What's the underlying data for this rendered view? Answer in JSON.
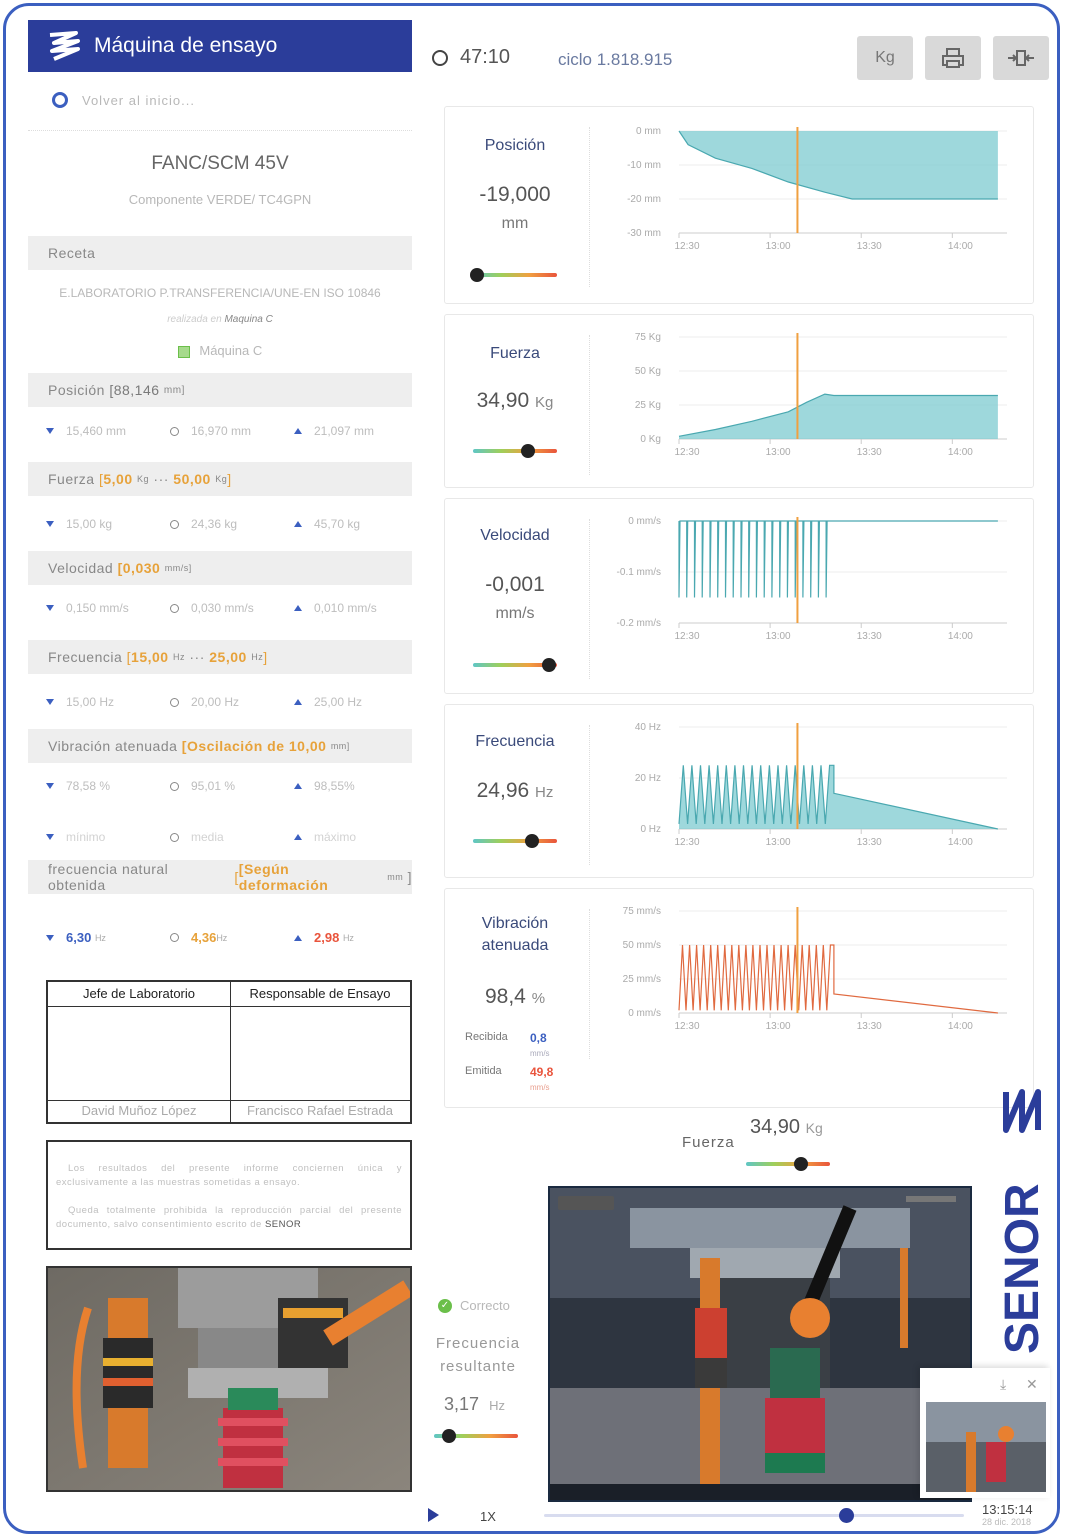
{
  "app": {
    "title": "Máquina de ensayo"
  },
  "topbar": {
    "timer": "47:10",
    "cycle": "ciclo 1.818.915",
    "unit_button": "Kg"
  },
  "nav": {
    "back": "Volver al inicio..."
  },
  "component": {
    "model": "FANC/SCM 45V",
    "subtitle": "Componente VERDE/ TC4GPN"
  },
  "recipe": {
    "header": "Receta",
    "text": "E.LABORATORIO P.TRANSFERENCIA/UNE-EN ISO 10846",
    "realized_prefix": "realizada en",
    "realized_machine": "Maquina C",
    "machine": "Máquina C"
  },
  "sections": {
    "posicion": {
      "label": "Posición",
      "range": "[88,146",
      "unit": "mm]",
      "min": "15,460 mm",
      "avg": "16,970 mm",
      "max": "21,097 mm"
    },
    "fuerza": {
      "label": "Fuerza",
      "open": "[",
      "v1": "5,00",
      "u1": "Kg",
      "sep": "···",
      "v2": "50,00",
      "u2": "Kg",
      "close": "]",
      "min": "15,00 kg",
      "avg": "24,36 kg",
      "max": "45,70 kg"
    },
    "velocidad": {
      "label": "Velocidad",
      "range": "[0,030",
      "unit": "mm/s]",
      "min": "0,150 mm/s",
      "avg": "0,030 mm/s",
      "max": "0,010 mm/s"
    },
    "frecuencia": {
      "label": "Frecuencia",
      "open": "[",
      "v1": "15,00",
      "u1": "Hz",
      "sep": "···",
      "v2": "25,00",
      "u2": "Hz",
      "close": "]",
      "min": "15,00 Hz",
      "avg": "20,00 Hz",
      "max": "25,00 Hz"
    },
    "vibracion": {
      "label": "Vibración atenuada",
      "range": "[Oscilación de 10,00",
      "unit": "mm]",
      "min": "78,58 %",
      "avg": "95,01 %",
      "max": "98,55%",
      "min2": "mínimo",
      "avg2": "media",
      "max2": "máximo"
    },
    "natural": {
      "label": "frecuencia natural obtenida",
      "range": "[Según deformación",
      "unit": "mm",
      "close": "]",
      "min": "6,30",
      "min_u": "Hz",
      "avg": "4,36",
      "avg_u": "Hz",
      "max": "2,98",
      "max_u": "Hz"
    }
  },
  "signatures": {
    "col1_header": "Jefe de Laboratorio",
    "col2_header": "Responsable de Ensayo",
    "col1_name": "David Muñoz López",
    "col2_name": "Francisco Rafael Estrada"
  },
  "disclaimer": {
    "p1": "Los resultados del presente informe conciernen única y exclusivamente a las muestras sometidas a ensayo.",
    "p2": "Queda totalmente prohibida la reproducción parcial del presente documento, salvo consentimiento escrito de",
    "brand": "SENOR"
  },
  "cards": {
    "posicion": {
      "title": "Posición",
      "value": "-19,000",
      "unit": "mm",
      "slider": 0.05
    },
    "fuerza": {
      "title": "Fuerza",
      "value": "34,90",
      "unit": "Kg",
      "slider": 0.65
    },
    "velocidad": {
      "title": "Velocidad",
      "value": "-0,001",
      "unit": "mm/s",
      "slider": 0.9
    },
    "frecuencia": {
      "title": "Frecuencia",
      "value": "24,96",
      "unit": "Hz",
      "slider": 0.7
    },
    "vibracion": {
      "title1": "Vibración",
      "title2": "atenuada",
      "value": "98,4",
      "unit": "%",
      "recv_label": "Recibida",
      "recv_val": "0,8",
      "recv_unit": "mm/s",
      "emit_label": "Emitida",
      "emit_val": "49,8",
      "emit_unit": "mm/s"
    }
  },
  "chart_data": [
    {
      "type": "area",
      "name": "Posición",
      "x_ticks": [
        "12:30",
        "13:00",
        "13:30",
        "14:00"
      ],
      "y_ticks": [
        "0 mm",
        "-10 mm",
        "-20 mm",
        "-30 mm"
      ],
      "ylim": [
        -30,
        0
      ],
      "x": [
        12.5,
        12.55,
        12.7,
        12.9,
        13.1,
        13.3,
        13.45,
        13.5,
        14.25
      ],
      "values": [
        0,
        -4,
        -8,
        -11,
        -15,
        -18,
        -20,
        -20,
        -20
      ],
      "marker_x": 13.15,
      "color": "#7ecbd0"
    },
    {
      "type": "area",
      "name": "Fuerza",
      "x_ticks": [
        "12:30",
        "13:00",
        "13:30",
        "14:00"
      ],
      "y_ticks": [
        "75 Kg",
        "50 Kg",
        "25 Kg",
        "0 Kg"
      ],
      "ylim": [
        0,
        75
      ],
      "x": [
        12.5,
        12.7,
        12.9,
        13.1,
        13.2,
        13.3,
        13.35,
        14.25
      ],
      "values": [
        2,
        7,
        13,
        20,
        27,
        33,
        32,
        32
      ],
      "marker_x": 13.15,
      "color": "#7ecbd0"
    },
    {
      "type": "line",
      "name": "Velocidad",
      "x_ticks": [
        "12:30",
        "13:00",
        "13:30",
        "14:00"
      ],
      "y_ticks": [
        "0 mm/s",
        "-0.1 mm/s",
        "-0.2 mm/s"
      ],
      "ylim": [
        -0.2,
        0
      ],
      "spikes": 20,
      "spike_min": -0.15,
      "x_end_spikes": 13.35,
      "marker_x": 13.15,
      "color": "#7ecbd0"
    },
    {
      "type": "area",
      "name": "Frecuencia",
      "x_ticks": [
        "12:30",
        "13:00",
        "13:30",
        "14:00"
      ],
      "y_ticks": [
        "40 Hz",
        "20 Hz",
        "0 Hz"
      ],
      "ylim": [
        0,
        40
      ],
      "teeth": 18,
      "peak": 25,
      "trough": 2,
      "x_end_teeth": 13.35,
      "marker_x": 13.15,
      "color": "#7ecbd0"
    },
    {
      "type": "line",
      "name": "Vibración atenuada",
      "x_ticks": [
        "12:30",
        "13:00",
        "13:30",
        "14:00"
      ],
      "y_ticks": [
        "75 mm/s",
        "50 mm/s",
        "25 mm/s",
        "0 mm/s"
      ],
      "ylim": [
        0,
        75
      ],
      "teeth": 22,
      "peak": 50,
      "trough": 2,
      "x_end_teeth": 13.35,
      "marker_x": 13.15,
      "color": "#e8825a"
    }
  ],
  "video": {
    "force_label": "Fuerza",
    "force_value": "34,90",
    "force_unit": "Kg",
    "status": "Correcto",
    "freq_label1": "Frecuencia",
    "freq_label2": "resultante",
    "freq_value": "3,17",
    "freq_unit": "Hz",
    "speed": "1X",
    "time": "13:15:14",
    "date": "28 dic. 2018",
    "progress": 0.72
  },
  "brand": "SENOR"
}
